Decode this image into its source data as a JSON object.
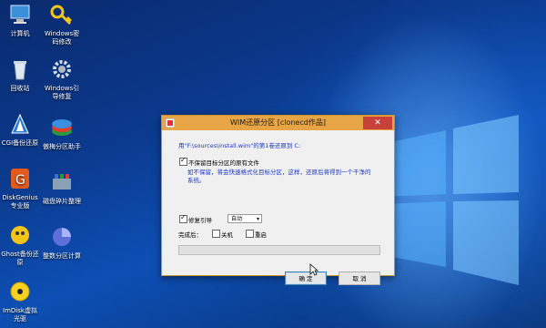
{
  "desktop": {
    "icons": [
      {
        "name": "computer-icon",
        "label": "计算机"
      },
      {
        "name": "recycle-bin-icon",
        "label": "回收站"
      },
      {
        "name": "cgi-backup-icon",
        "label": "CGI备份还原"
      },
      {
        "name": "diskgenius-icon",
        "label": "DiskGenius\n专业版"
      },
      {
        "name": "ghost-backup-icon",
        "label": "Ghost备份还\n原"
      },
      {
        "name": "imdisk-icon",
        "label": "ImDisk虚拟\n光驱"
      },
      {
        "name": "windows-password-icon",
        "label": "Windows密\n码修改"
      },
      {
        "name": "windows-boot-repair-icon",
        "label": "Windows引\n导修复"
      },
      {
        "name": "partition-assistant-icon",
        "label": "傲梅分区助手"
      },
      {
        "name": "disk-defrag-icon",
        "label": "磁盘碎片整理"
      },
      {
        "name": "partition-calc-icon",
        "label": "整数分区计算"
      }
    ]
  },
  "dialog": {
    "title": "WIM还原分区  [clonecd作品]",
    "close_label": "✕",
    "source_text": "用\"F:\\sources\\install.wim\"的第1卷还原到 C:",
    "keep_files_label": "不保留目标分区的原有文件",
    "keep_files_checked": true,
    "keep_files_desc_line1": "如不保留，将会快速格式化目标分区，这样，还原后将得到一个干净的",
    "keep_files_desc_line2": "系统。",
    "repair_boot_label": "修复引导",
    "repair_boot_checked": true,
    "boot_mode_value": "自动",
    "after_label": "完成后：",
    "shutdown_label": "关机",
    "shutdown_checked": false,
    "restart_label": "重启",
    "restart_checked": false,
    "progress": 0,
    "ok_label": "确 定",
    "cancel_label": "取 消"
  }
}
